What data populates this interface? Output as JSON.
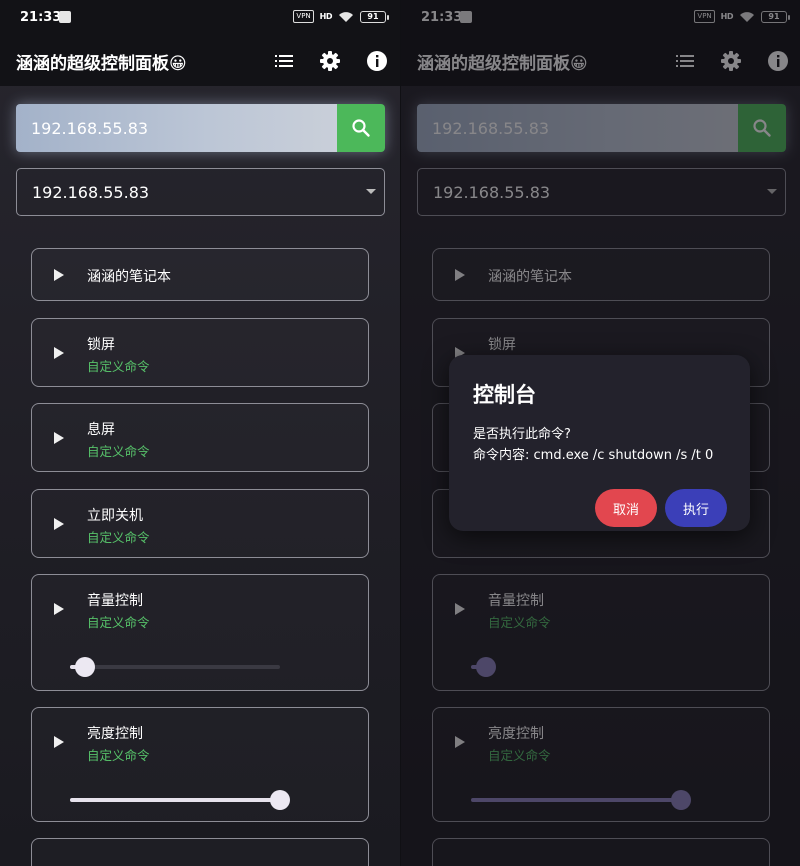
{
  "status": {
    "time": "21:33",
    "vpn": "VPN",
    "signal": "HD",
    "battery": "91"
  },
  "app": {
    "title": "涵涵的超级控制面板😀"
  },
  "search": {
    "value": "192.168.55.83"
  },
  "device_select": {
    "value": "192.168.55.83"
  },
  "cards": [
    {
      "title": "涵涵的笔记本",
      "subtitle": ""
    },
    {
      "title": "锁屏",
      "subtitle": "自定义命令"
    },
    {
      "title": "息屏",
      "subtitle": "自定义命令"
    },
    {
      "title": "立即关机",
      "subtitle": "自定义命令"
    },
    {
      "title": "音量控制",
      "subtitle": "自定义命令"
    },
    {
      "title": "亮度控制",
      "subtitle": "自定义命令"
    }
  ],
  "sliders": {
    "volume": 0.07,
    "brightness": 1.0
  },
  "dialog": {
    "title": "控制台",
    "question": "是否执行此命令?",
    "command": "命令内容: cmd.exe /c shutdown /s /t 0",
    "cancel": "取消",
    "execute": "执行"
  },
  "colors": {
    "accent_green": "#4cb85a",
    "cancel_red": "#e2474f",
    "execute_blue": "#3b3fb8",
    "slider_purple": "#7a6fa8"
  },
  "icons": [
    "list-icon",
    "settings-gear-icon",
    "info-icon",
    "search-icon",
    "play-arrow-icon",
    "dropdown-caret-icon"
  ]
}
